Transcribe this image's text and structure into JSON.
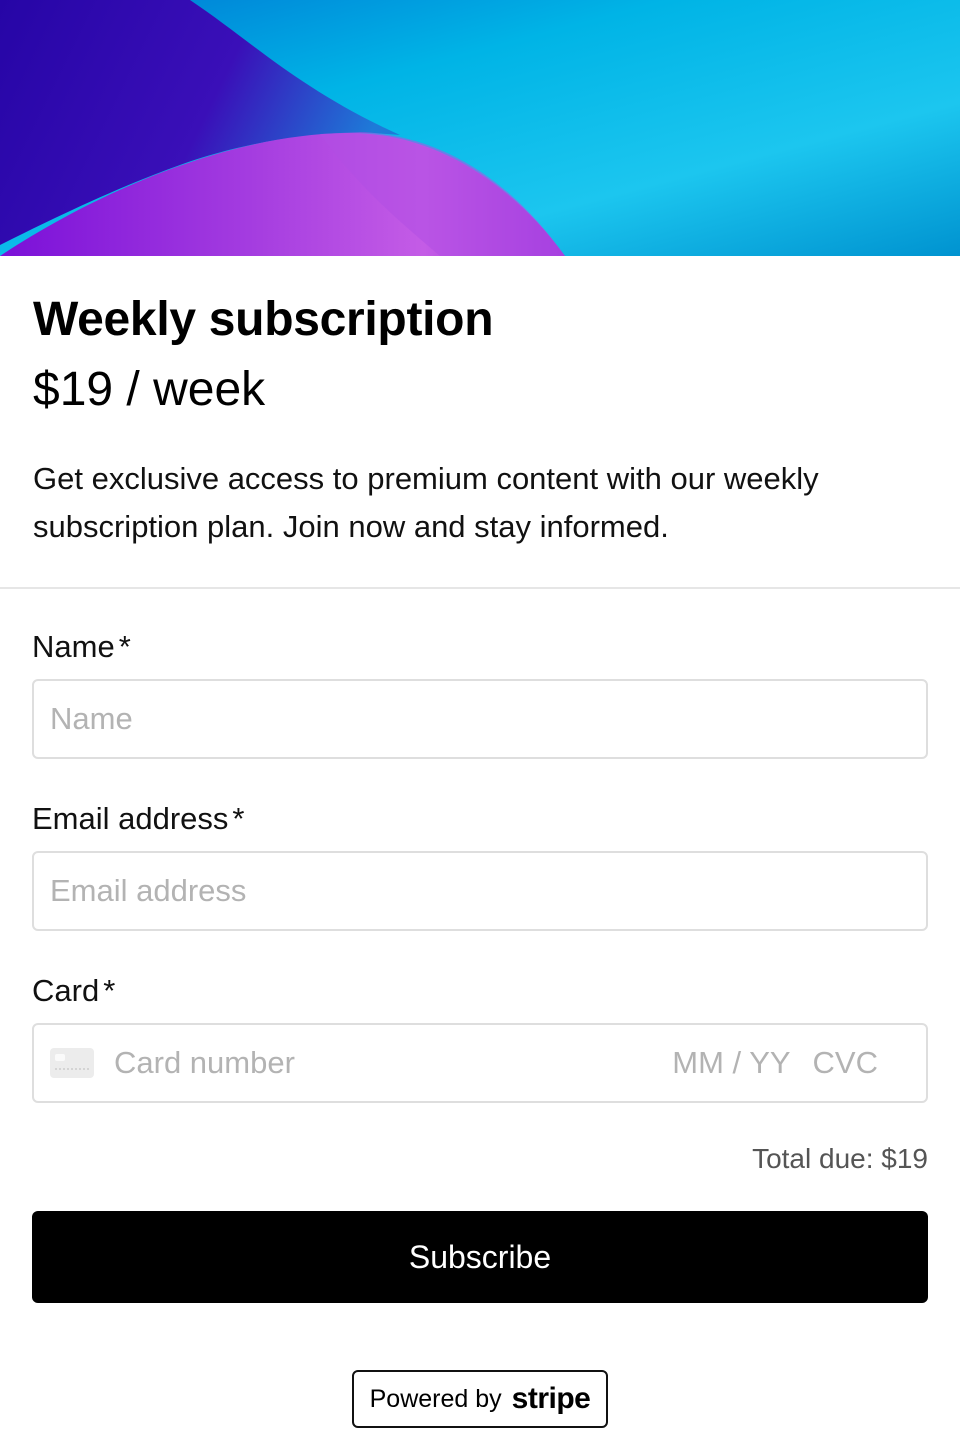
{
  "header": {
    "title": "Weekly subscription",
    "price": "$19 / week",
    "description": "Get exclusive access to premium content with our weekly subscription plan. Join now and stay informed."
  },
  "form": {
    "name": {
      "label": "Name",
      "required_mark": "*",
      "placeholder": "Name",
      "value": ""
    },
    "email": {
      "label": "Email address",
      "required_mark": "*",
      "placeholder": "Email address",
      "value": ""
    },
    "card": {
      "label": "Card",
      "required_mark": "*",
      "number_placeholder": "Card number",
      "expiry_placeholder": "MM / YY",
      "cvc_placeholder": "CVC"
    },
    "total_due": "Total due: $19",
    "submit_label": "Subscribe"
  },
  "footer": {
    "powered_prefix": "Powered by",
    "powered_brand": "stripe"
  },
  "colors": {
    "button_bg": "#000000",
    "hero_blue": "#00bde8",
    "hero_purple": "#8a1ad6",
    "hero_indigo": "#2a0ca8"
  }
}
